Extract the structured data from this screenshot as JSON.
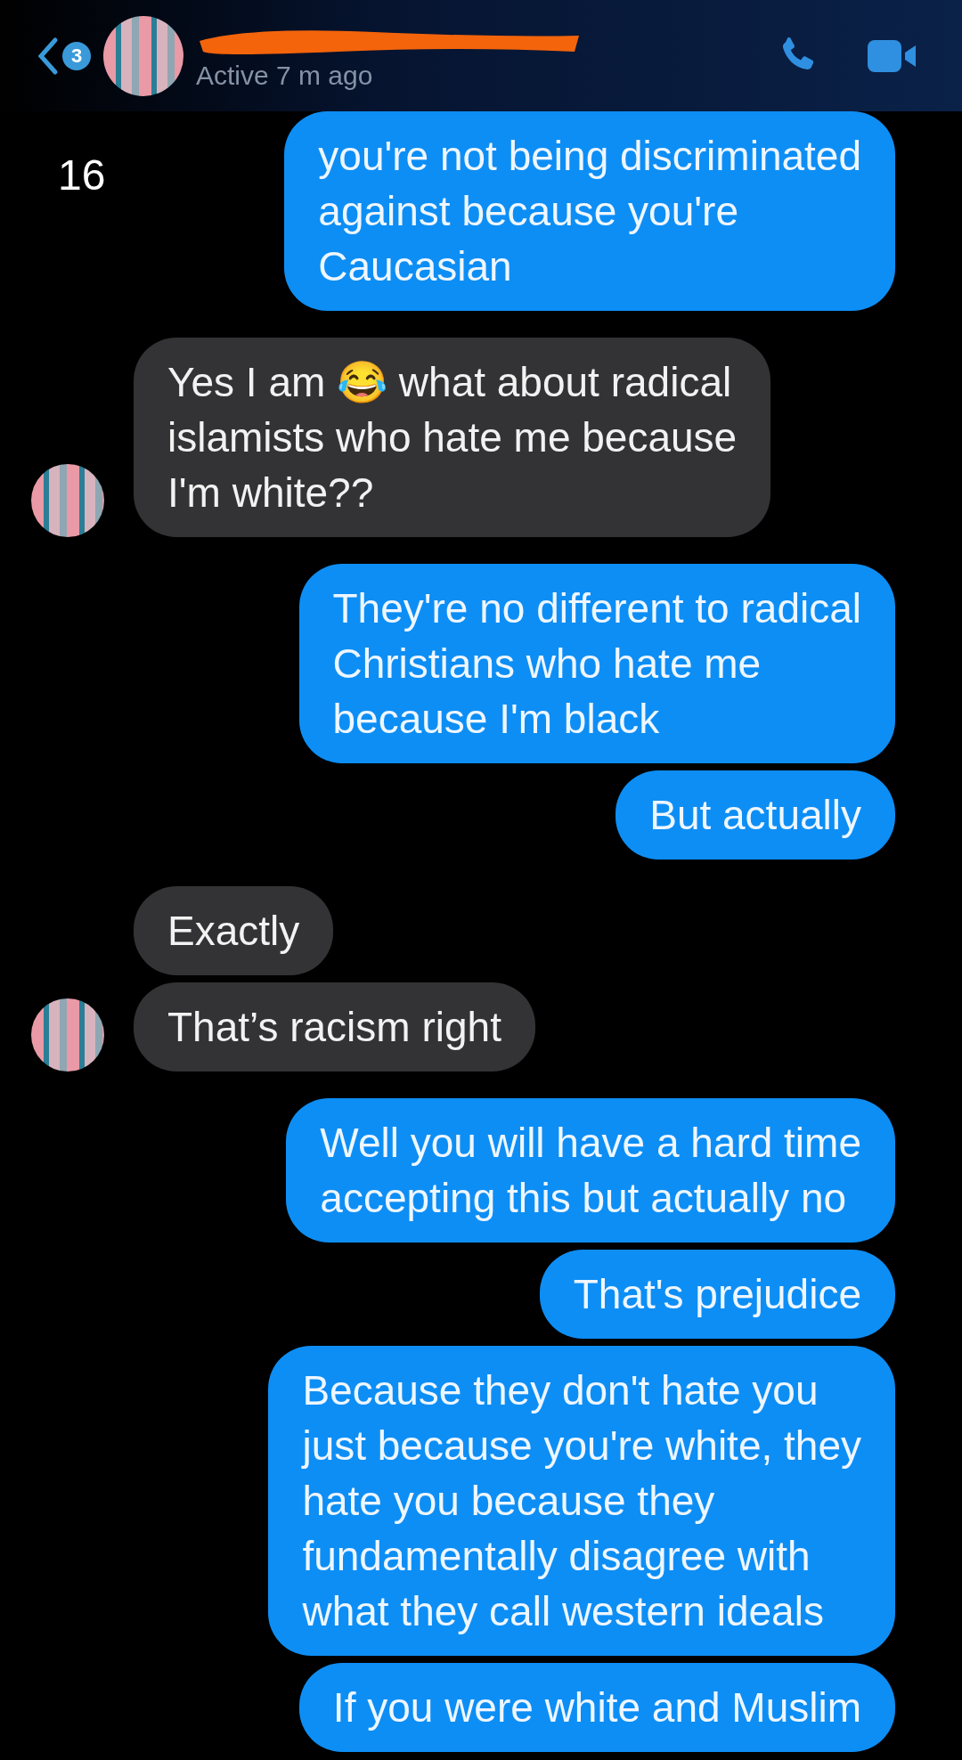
{
  "header": {
    "back_badge": "3",
    "status": "Active 7 m ago",
    "name_redacted": true
  },
  "side_text": "16",
  "messages": [
    {
      "kind": "sent",
      "text": "you're not being discriminated\nagainst because you're\nCaucasian"
    },
    {
      "kind": "received",
      "text": "Yes I am 😂 what about radical\nislamists who hate me because\nI'm white??",
      "show_avatar": true
    },
    {
      "kind": "sent",
      "text": "They're no different to radical\nChristians who hate me\nbecause I'm black"
    },
    {
      "kind": "sent",
      "text": "But actually"
    },
    {
      "kind": "received",
      "text": "Exactly",
      "show_avatar": false
    },
    {
      "kind": "received",
      "text": "That’s racism right",
      "show_avatar": true
    },
    {
      "kind": "sent",
      "text": "Well you will have a hard time\naccepting this but actually no"
    },
    {
      "kind": "sent",
      "text": "That's prejudice"
    },
    {
      "kind": "sent",
      "text": "Because they don't hate you\njust because you're white, they\nhate you because they\nfundamentally disagree with\nwhat they call western ideals"
    },
    {
      "kind": "sent",
      "text": "If you were white and Muslim"
    }
  ]
}
